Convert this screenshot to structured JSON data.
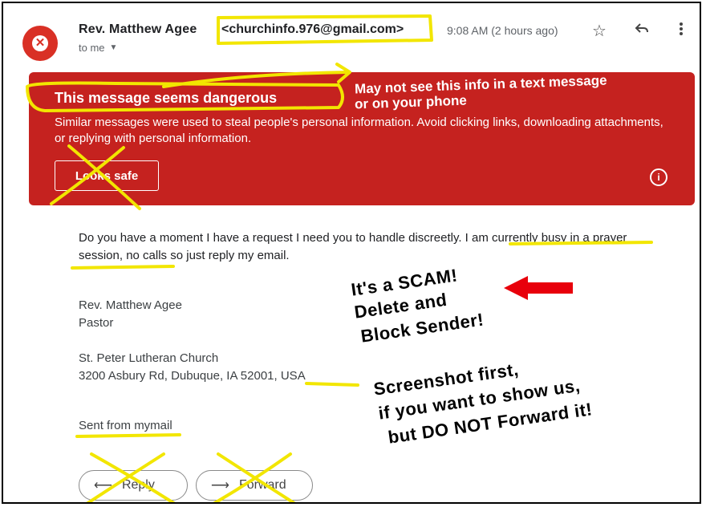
{
  "header": {
    "sender_name": "Rev. Matthew Agee",
    "sender_email": "<churchinfo.976@gmail.com>",
    "to_label": "to me",
    "time": "9:08 AM (2 hours ago)",
    "avatar_glyph": "✕"
  },
  "banner": {
    "title": "This message seems dangerous",
    "text": "Similar messages were used to steal people's personal information. Avoid clicking links, downloading attachments, or replying with personal information.",
    "button_label": "Looks safe",
    "color": "#c5221f"
  },
  "message": {
    "body": "Do you have a moment I have a request I need you to handle discreetly. I am currently busy in a prayer session, no calls so just reply my email.",
    "sig_name": "Rev. Matthew Agee",
    "sig_title": "Pastor",
    "sig_org": "St. Peter Lutheran Church",
    "sig_address": "3200 Asbury Rd, Dubuque, IA 52001, USA",
    "sent_from": "Sent from mymail"
  },
  "actions": {
    "reply_label": "Reply",
    "forward_label": "Forward"
  },
  "annotations": {
    "banner_note_1": "May not see this info in a text message",
    "banner_note_2": "or on your phone",
    "scam_1": "It's a SCAM!",
    "scam_2": "Delete and",
    "scam_3": "Block Sender!",
    "shot_1": "Screenshot first,",
    "shot_2": "if you want to show us,",
    "shot_3": "but DO NOT Forward it!",
    "highlight_color": "#f2e600",
    "arrow_color": "#e8000b"
  }
}
